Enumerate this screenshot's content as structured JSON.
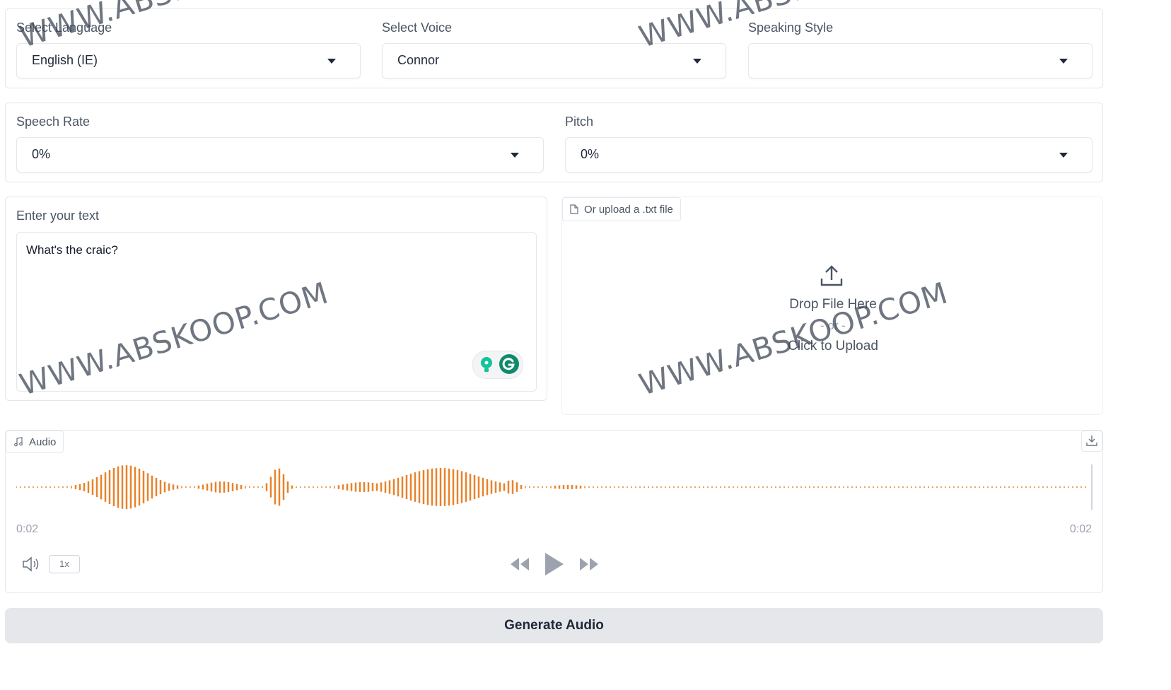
{
  "language": {
    "label": "Select Language",
    "value": "English (IE)"
  },
  "voice": {
    "label": "Select Voice",
    "value": "Connor"
  },
  "style": {
    "label": "Speaking Style",
    "value": ""
  },
  "rate": {
    "label": "Speech Rate",
    "value": "0%"
  },
  "pitch": {
    "label": "Pitch",
    "value": "0%"
  },
  "text_input": {
    "label": "Enter your text",
    "value": "What's the craic?"
  },
  "upload": {
    "tab_label": "Or upload a .txt file",
    "drop_text": "Drop File Here",
    "or_text": "- or -",
    "click_text": "Click to Upload"
  },
  "audio": {
    "label": "Audio",
    "current_time": "0:02",
    "duration": "0:02",
    "speed": "1x",
    "waveform_color": "#e8822a"
  },
  "generate_label": "Generate Audio",
  "watermark": "WWW.ABSKOOP.COM",
  "icons": {
    "dropdown": "chevron-down-icon",
    "file": "file-icon",
    "upload": "upload-icon",
    "music": "music-note-icon",
    "download": "download-icon",
    "volume": "volume-icon",
    "rewind": "rewind-icon",
    "play": "play-icon",
    "forward": "fast-forward-icon",
    "grammarly": "grammarly-icon",
    "lightbulb": "lightbulb-icon"
  }
}
